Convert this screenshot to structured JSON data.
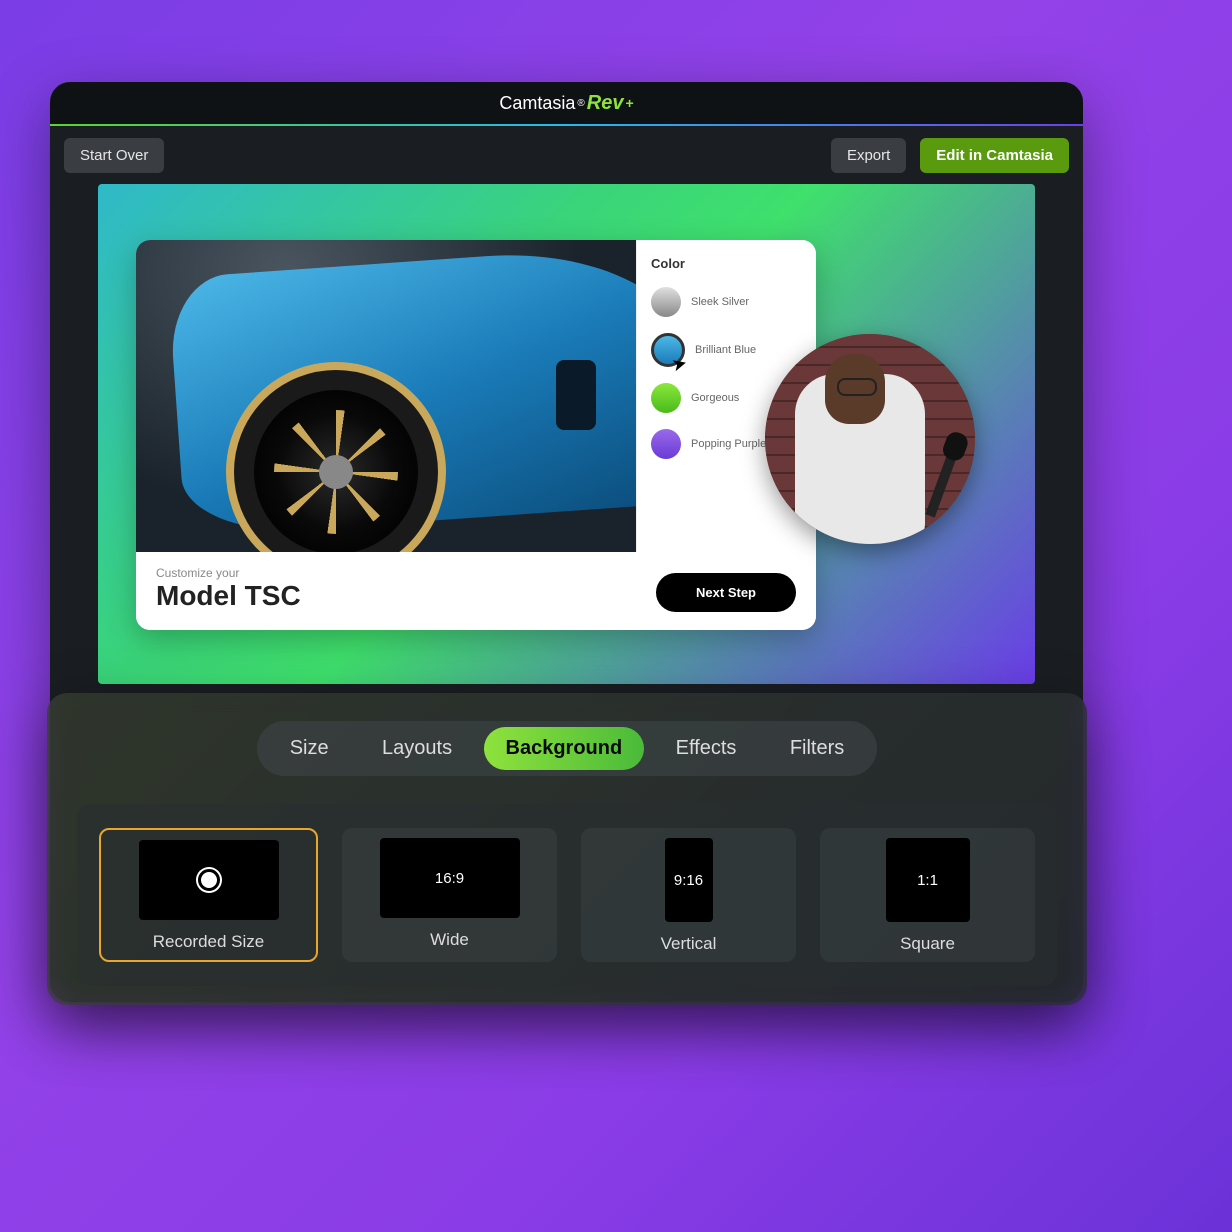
{
  "brand": {
    "main": "Camtasia",
    "sub": "Rev",
    "plus": "+"
  },
  "toolbar": {
    "start_over": "Start Over",
    "export": "Export",
    "edit": "Edit in Camtasia"
  },
  "preview": {
    "color_title": "Color",
    "swatches": [
      {
        "name": "Sleek Silver"
      },
      {
        "name": "Brilliant Blue"
      },
      {
        "name": "Gorgeous"
      },
      {
        "name": "Popping Purple"
      }
    ],
    "customize_label": "Customize your",
    "model_name": "Model TSC",
    "next_button": "Next Step"
  },
  "tabs": {
    "size": "Size",
    "layouts": "Layouts",
    "background": "Background",
    "effects": "Effects",
    "filters": "Filters",
    "active": "Background"
  },
  "size_options": [
    {
      "key": "recorded",
      "label": "Recorded Size",
      "ratio": "",
      "selected": true
    },
    {
      "key": "wide",
      "label": "Wide",
      "ratio": "16:9",
      "selected": false
    },
    {
      "key": "vertical",
      "label": "Vertical",
      "ratio": "9:16",
      "selected": false
    },
    {
      "key": "square",
      "label": "Square",
      "ratio": "1:1",
      "selected": false
    }
  ]
}
